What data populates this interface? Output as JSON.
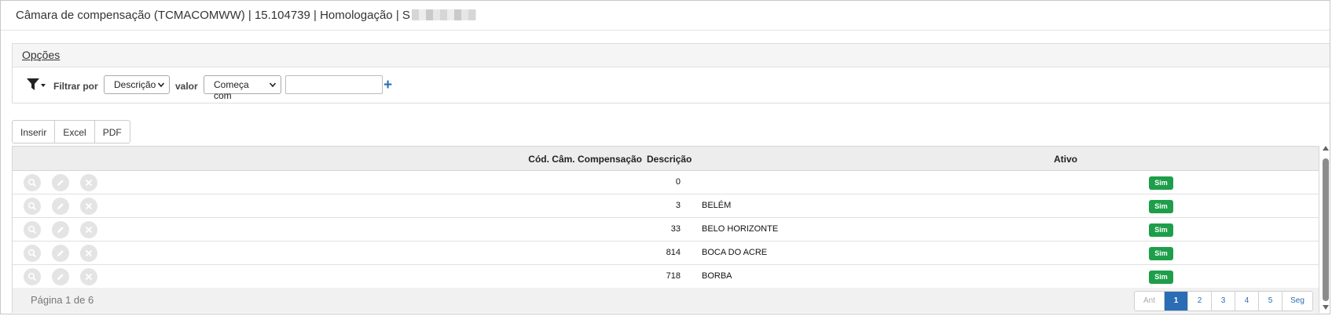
{
  "window": {
    "title": "Câmara de compensação (TCMACOMWW) | 15.104739 | Homologação | S"
  },
  "options": {
    "title": "Opções",
    "filter_by_label": "Filtrar por",
    "filter_field": "Descrição",
    "value_label": "valor",
    "operator": "Começa com",
    "value_input": "",
    "add_symbol": "+"
  },
  "toolbar": {
    "insert_label": "Inserir",
    "excel_label": "Excel",
    "pdf_label": "PDF"
  },
  "table": {
    "headers": {
      "code": "Cód. Câm. Compensação",
      "description": "Descrição",
      "active": "Ativo"
    },
    "rows": [
      {
        "code": "0",
        "description": "",
        "active": "Sim"
      },
      {
        "code": "3",
        "description": "BELÉM",
        "active": "Sim"
      },
      {
        "code": "33",
        "description": "BELO HORIZONTE",
        "active": "Sim"
      },
      {
        "code": "814",
        "description": "BOCA DO ACRE",
        "active": "Sim"
      },
      {
        "code": "718",
        "description": "BORBA",
        "active": "Sim"
      }
    ],
    "row_icons": [
      "search-icon",
      "edit-icon",
      "close-icon"
    ]
  },
  "pagination": {
    "info": "Página 1 de 6",
    "prev_label": "Ant",
    "pages": [
      "1",
      "2",
      "3",
      "4",
      "5"
    ],
    "next_label": "Seg",
    "current": "1"
  },
  "colors": {
    "accent": "#2a6db5",
    "active_badge": "#1e9e4a"
  }
}
